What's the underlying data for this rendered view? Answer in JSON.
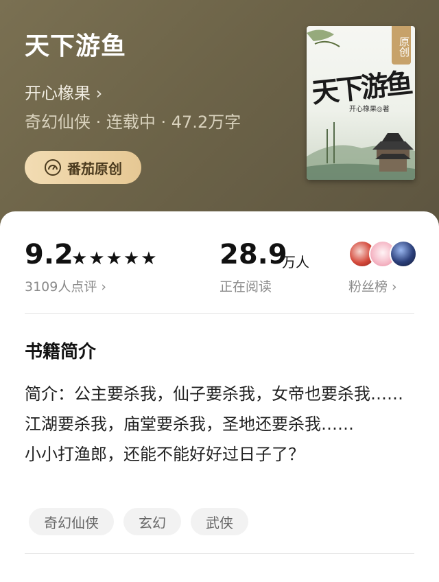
{
  "book": {
    "title": "天下游鱼",
    "author_link": "开心橡果 ›",
    "meta": "奇幻仙侠 · 连载中 · 47.2万字",
    "badge_label": "番茄原创",
    "cover": {
      "tag": "原创",
      "title": "天下游鱼",
      "author": "开心橡果◎著"
    }
  },
  "stats": {
    "score": "9.2",
    "stars": "★★★★★",
    "reviews_label": "3109人点评 ›",
    "readers_value": "28.9",
    "readers_unit": "万人",
    "reading_label": "正在阅读",
    "fans_label": "粉丝榜 ›"
  },
  "intro": {
    "section_title": "书籍简介",
    "lines": [
      "简介：公主要杀我，仙子要杀我，女帝也要杀我……",
      "江湖要杀我，庙堂要杀我，圣地还要杀我……",
      "小小打渔郎，还能不能好好过日子了？"
    ]
  },
  "tags": [
    "奇幻仙侠",
    "玄幻",
    "武侠"
  ],
  "colors": {
    "header_bg": "#6c6348",
    "badge_bg": "#e6c894",
    "cover_tag": "#c7a26a",
    "tag_bg": "#f2f2f2"
  }
}
